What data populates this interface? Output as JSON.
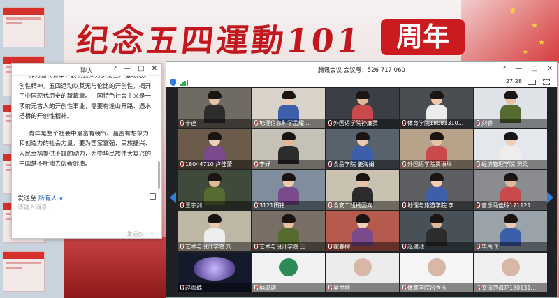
{
  "slide": {
    "banner_title": "纪念五四運動101",
    "banner_badge": "周年",
    "colors": {
      "accent": "#c2171c",
      "badge_bg": "#cc1b1f"
    }
  },
  "chat": {
    "title": "聊天",
    "controls": [
      "?",
      "—",
      "□",
      "✕"
    ],
    "messages": [
      "作为当代青年，我们要大力弘扬五四运动的开创性精神。五四运动以其无与伦比的开创性，揭开了中国现代历史的新篇章。中国特色社会主义是一项前无古人的开创性事业，需要有逢山开路、遇水搭桥的开创性精神。",
      "青年是整个社会中最富有朝气、最富有想象力和创造力的社会力量，要为国家富强、民族振兴、人民幸福提供不竭的动力，为中华民族伟大复兴的中国梦不断地去创新创造。"
    ],
    "send_to_label": "发送至",
    "send_to_target": "所有人",
    "input_placeholder": "请输入消息...",
    "send_button": "发送(S)"
  },
  "meeting": {
    "title": "腾讯会议 会议号：526 717 060",
    "controls": [
      "?",
      "—",
      "□",
      "✕"
    ],
    "timer": "27:28",
    "participants": [
      {
        "name": "于迪"
      },
      {
        "name": "地理信息科学孟耀..."
      },
      {
        "name": "外国语学院孙廉贡"
      },
      {
        "name": "体育学院18081310..."
      },
      {
        "name": "刘睿"
      },
      {
        "name": "18044710 卢佳蕾"
      },
      {
        "name": "李妤"
      },
      {
        "name": "食品学院 姜海娟"
      },
      {
        "name": "外国语学院贾琳琳"
      },
      {
        "name": "经济管理学院 况柔"
      },
      {
        "name": "王宇剑"
      },
      {
        "name": "3121田铭"
      },
      {
        "name": "食安二班杨圆宾"
      },
      {
        "name": "地理与旅游学院 李..."
      },
      {
        "name": "音乐马佳玲171121..."
      },
      {
        "name": "艺术与设计学院 刘..."
      },
      {
        "name": "艺术与设计学院 王..."
      },
      {
        "name": "霍春柳"
      },
      {
        "name": "赵建池"
      },
      {
        "name": "毕禹飞"
      },
      {
        "name": "赵雨璐"
      },
      {
        "name": "纳鎏迦"
      },
      {
        "name": "吴世翀"
      },
      {
        "name": "体育学院吕秀玉"
      },
      {
        "name": "文法范海花180131..."
      }
    ]
  }
}
